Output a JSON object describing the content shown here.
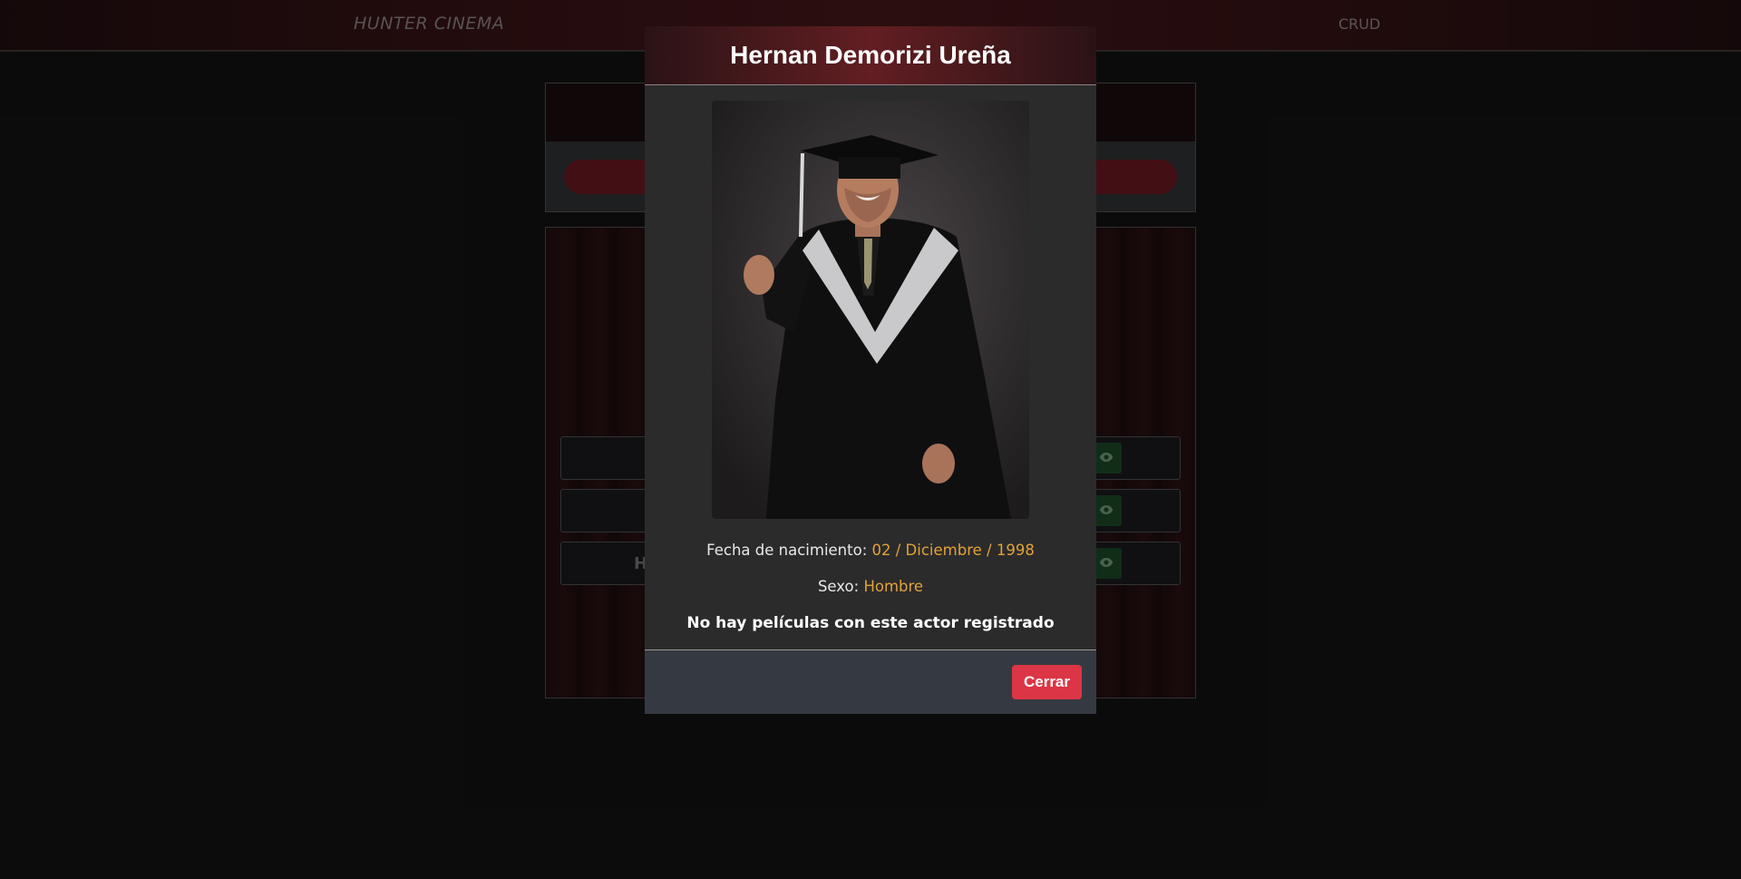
{
  "navbar": {
    "brand": "HUNTER CINEMA",
    "links": [
      "CRUD"
    ]
  },
  "background_list": {
    "rows": [
      {
        "initial": ""
      },
      {
        "initial": ""
      },
      {
        "initial": "H"
      }
    ],
    "row_action_icon": "eye-icon"
  },
  "modal": {
    "title": "Hernan Demorizi Ureña",
    "birth_label": "Fecha de nacimiento:",
    "birth_value": "02 / Diciembre / 1998",
    "sex_label": "Sexo:",
    "sex_value": "Hombre",
    "no_movies_text": "No hay películas con este actor registrado",
    "close_label": "Cerrar"
  },
  "colors": {
    "accent_orange": "#e2a23a",
    "close_button": "#dc3545",
    "view_button": "#1e4f2a"
  }
}
